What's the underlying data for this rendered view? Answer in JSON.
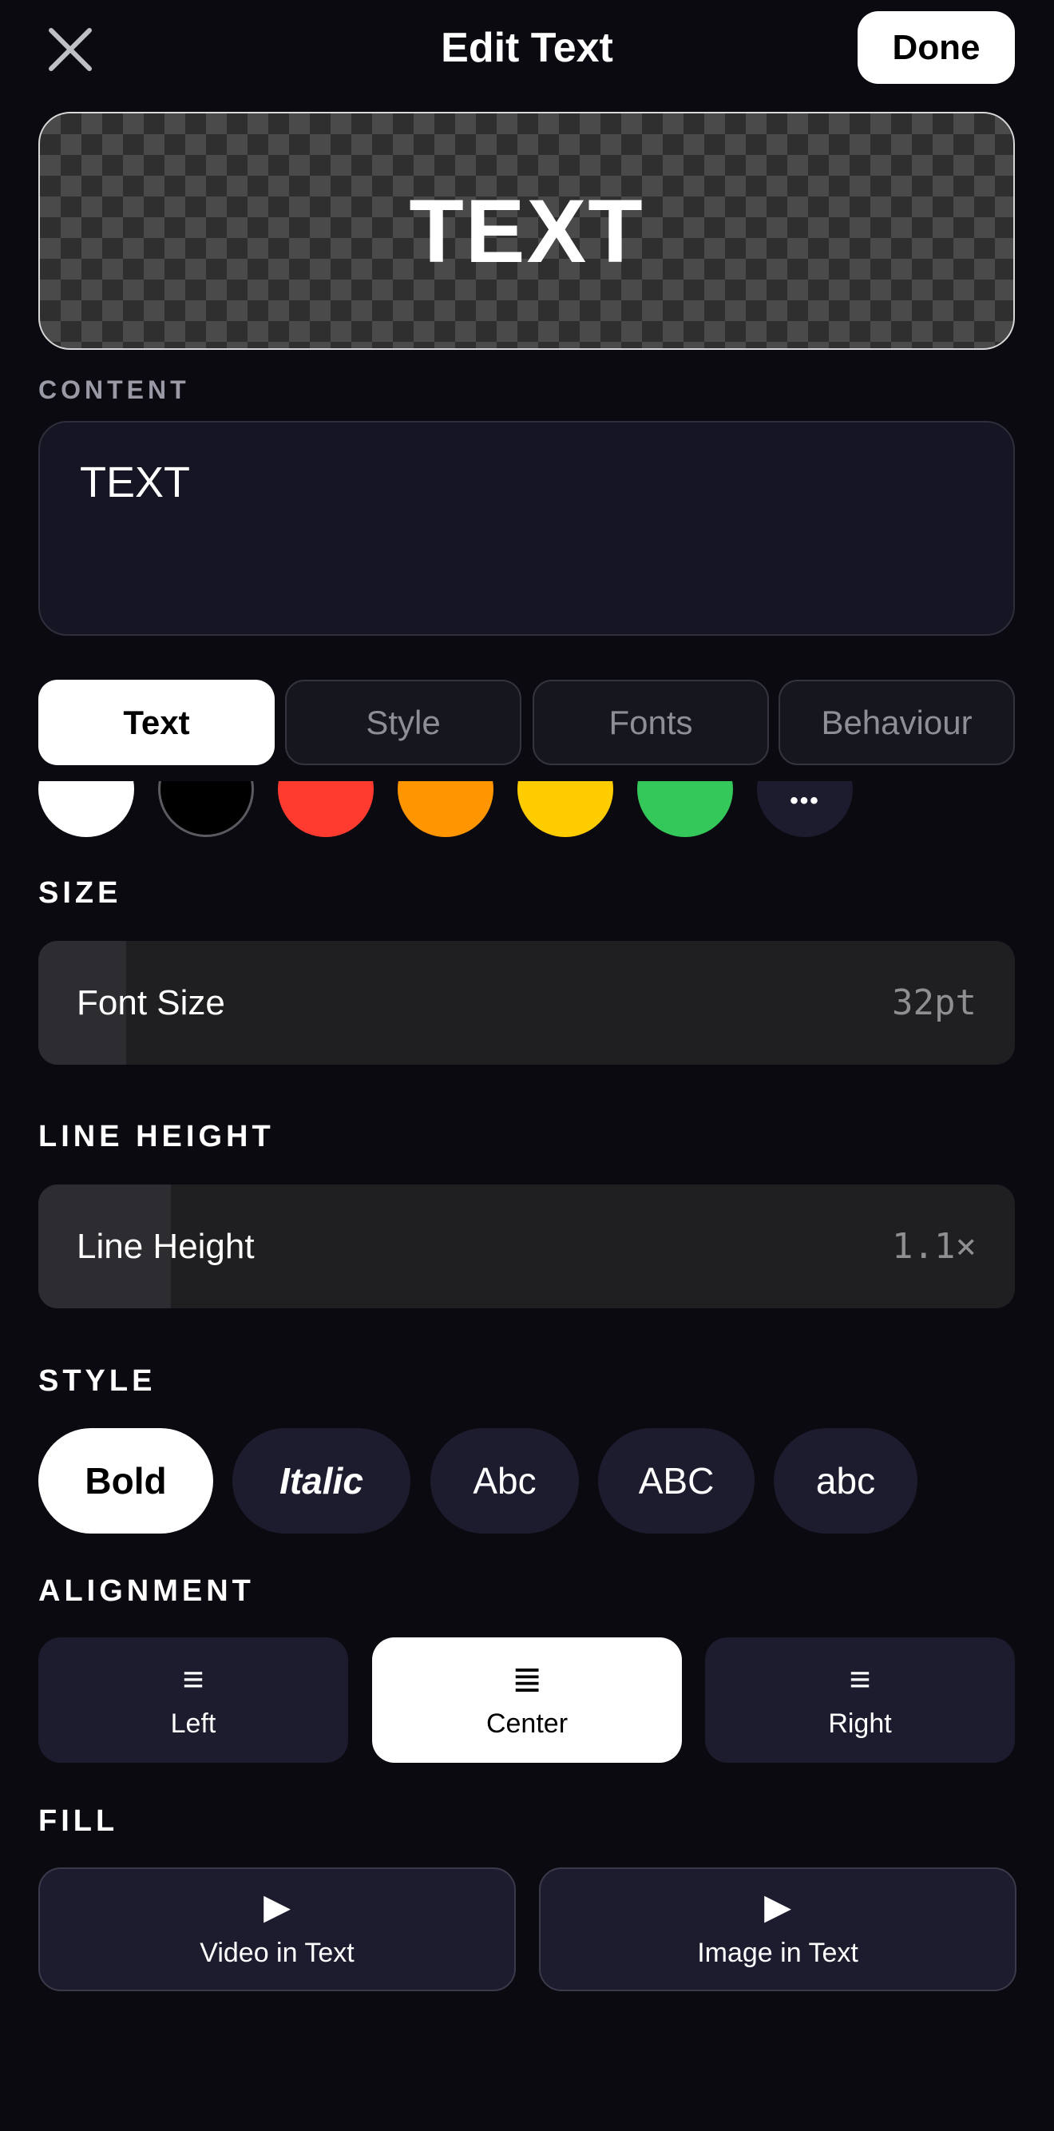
{
  "header": {
    "title": "Edit Text",
    "close_icon": "close-x-icon",
    "done_label": "Done"
  },
  "preview": {
    "text": "TEXT"
  },
  "content": {
    "label": "CONTENT",
    "value": "TEXT"
  },
  "tabs": [
    {
      "label": "Text",
      "active": true
    },
    {
      "label": "Style",
      "active": false
    },
    {
      "label": "Fonts",
      "active": false
    },
    {
      "label": "Behaviour",
      "active": false
    }
  ],
  "colors": {
    "swatches": [
      "#ffffff",
      "#000000",
      "#ff3b30",
      "#ff9500",
      "#ffcc00",
      "#34c759"
    ],
    "more_label": "•••"
  },
  "size": {
    "section_label": "SIZE",
    "slider_label": "Font Size",
    "value": "32pt",
    "fill_fraction": 0.09
  },
  "line_height": {
    "section_label": "LINE HEIGHT",
    "slider_label": "Line Height",
    "value": "1.1×",
    "fill_fraction": 0.136
  },
  "style": {
    "section_label": "STYLE",
    "pills": [
      {
        "label": "Bold",
        "active": true
      },
      {
        "label": "Italic",
        "active": false
      },
      {
        "label": "Abc",
        "active": false
      },
      {
        "label": "ABC",
        "active": false
      },
      {
        "label": "abc",
        "active": false
      }
    ]
  },
  "alignment": {
    "section_label": "ALIGNMENT",
    "options": [
      {
        "label": "Left",
        "icon": "≡",
        "active": false
      },
      {
        "label": "Center",
        "icon": "≣",
        "active": true
      },
      {
        "label": "Right",
        "icon": "≡",
        "active": false
      }
    ]
  },
  "fill": {
    "section_label": "FILL",
    "options": [
      {
        "label": "Video in Text",
        "icon": "▶"
      },
      {
        "label": "Image in Text",
        "icon": "▶"
      }
    ]
  }
}
